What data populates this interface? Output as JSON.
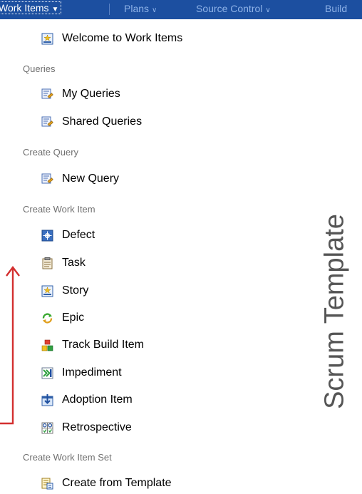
{
  "navbar": {
    "tabs": [
      {
        "label": "Work Items",
        "active": true
      },
      {
        "label": "Plans",
        "active": false
      },
      {
        "label": "Source Control",
        "active": false
      },
      {
        "label": "Build",
        "active": false
      }
    ]
  },
  "menu": {
    "welcome": {
      "label": "Welcome to Work Items",
      "icon": "welcome-icon"
    },
    "queries": {
      "heading": "Queries",
      "items": [
        {
          "label": "My Queries",
          "icon": "query-icon"
        },
        {
          "label": "Shared Queries",
          "icon": "query-icon"
        }
      ]
    },
    "create_query": {
      "heading": "Create Query",
      "items": [
        {
          "label": "New Query",
          "icon": "query-icon"
        }
      ]
    },
    "create_work_item": {
      "heading": "Create Work Item",
      "items": [
        {
          "label": "Defect",
          "icon": "defect-icon"
        },
        {
          "label": "Task",
          "icon": "task-icon"
        },
        {
          "label": "Story",
          "icon": "story-icon"
        },
        {
          "label": "Epic",
          "icon": "epic-icon"
        },
        {
          "label": "Track Build Item",
          "icon": "track-build-icon"
        },
        {
          "label": "Impediment",
          "icon": "impediment-icon"
        },
        {
          "label": "Adoption Item",
          "icon": "adoption-icon"
        },
        {
          "label": "Retrospective",
          "icon": "retrospective-icon"
        }
      ]
    },
    "create_work_item_set": {
      "heading": "Create Work Item Set",
      "items": [
        {
          "label": "Create from Template",
          "icon": "template-icon"
        }
      ]
    }
  },
  "annotation": {
    "label": "Scrum Template",
    "color": "#555555"
  },
  "colors": {
    "nav_bg": "#1c4fa0",
    "arrow": "#d32f2f"
  }
}
